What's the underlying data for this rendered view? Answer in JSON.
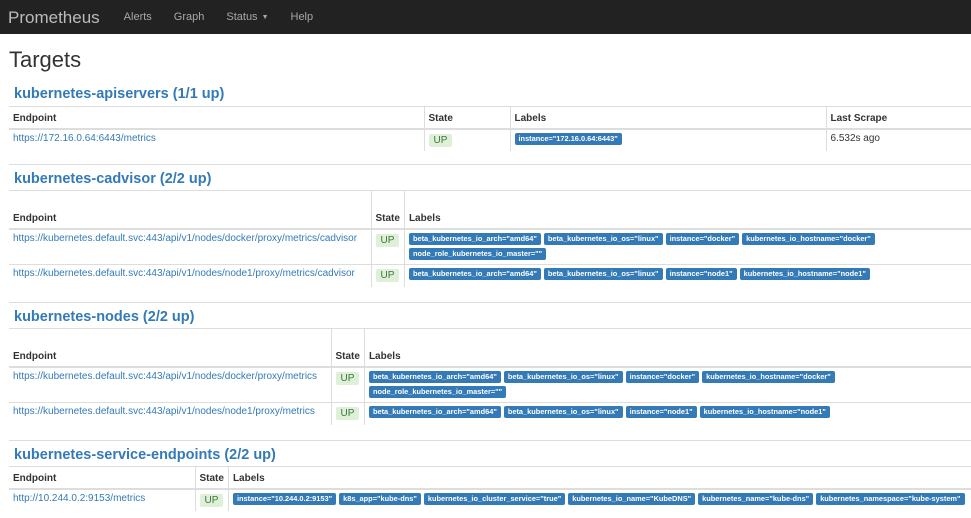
{
  "nav": {
    "brand": "Prometheus",
    "items": [
      {
        "label": "Alerts"
      },
      {
        "label": "Graph"
      },
      {
        "label": "Status"
      },
      {
        "label": "Help"
      }
    ]
  },
  "page_title": "Targets",
  "jobs": [
    {
      "title": "kubernetes-apiservers (1/1 up)",
      "headers": [
        "Endpoint",
        "State",
        "Labels",
        "Last Scrape"
      ],
      "rows": [
        {
          "endpoint": "https://172.16.0.64:6443/metrics",
          "state": "UP",
          "labels": [
            "instance=\"172.16.0.64:6443\""
          ],
          "last_scrape": "6.532s ago"
        }
      ]
    },
    {
      "title": "kubernetes-cadvisor (2/2 up)",
      "headers": [
        "Endpoint",
        "State",
        "Labels"
      ],
      "rows": [
        {
          "endpoint": "https://kubernetes.default.svc:443/api/v1/nodes/docker/proxy/metrics/cadvisor",
          "state": "UP",
          "labels": [
            "beta_kubernetes_io_arch=\"amd64\"",
            "beta_kubernetes_io_os=\"linux\"",
            "instance=\"docker\"",
            "kubernetes_io_hostname=\"docker\"",
            "node_role_kubernetes_io_master=\"\""
          ]
        },
        {
          "endpoint": "https://kubernetes.default.svc:443/api/v1/nodes/node1/proxy/metrics/cadvisor",
          "state": "UP",
          "labels": [
            "beta_kubernetes_io_arch=\"amd64\"",
            "beta_kubernetes_io_os=\"linux\"",
            "instance=\"node1\"",
            "kubernetes_io_hostname=\"node1\""
          ]
        }
      ]
    },
    {
      "title": "kubernetes-nodes (2/2 up)",
      "headers": [
        "Endpoint",
        "State",
        "Labels"
      ],
      "rows": [
        {
          "endpoint": "https://kubernetes.default.svc:443/api/v1/nodes/docker/proxy/metrics",
          "state": "UP",
          "labels": [
            "beta_kubernetes_io_arch=\"amd64\"",
            "beta_kubernetes_io_os=\"linux\"",
            "instance=\"docker\"",
            "kubernetes_io_hostname=\"docker\"",
            "node_role_kubernetes_io_master=\"\""
          ]
        },
        {
          "endpoint": "https://kubernetes.default.svc:443/api/v1/nodes/node1/proxy/metrics",
          "state": "UP",
          "labels": [
            "beta_kubernetes_io_arch=\"amd64\"",
            "beta_kubernetes_io_os=\"linux\"",
            "instance=\"node1\"",
            "kubernetes_io_hostname=\"node1\""
          ]
        }
      ]
    },
    {
      "title": "kubernetes-service-endpoints (2/2 up)",
      "headers": [
        "Endpoint",
        "State",
        "Labels"
      ],
      "rows": [
        {
          "endpoint": "http://10.244.0.2:9153/metrics",
          "state": "UP",
          "labels": [
            "instance=\"10.244.0.2:9153\"",
            "k8s_app=\"kube-dns\"",
            "kubernetes_io_cluster_service=\"true\"",
            "kubernetes_io_name=\"KubeDNS\"",
            "kubernetes_name=\"kube-dns\"",
            "kubernetes_namespace=\"kube-system\""
          ]
        }
      ]
    }
  ]
}
